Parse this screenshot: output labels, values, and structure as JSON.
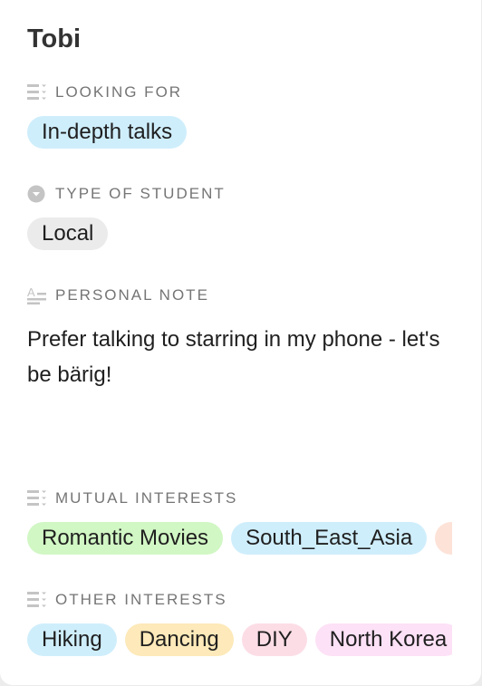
{
  "record": {
    "name": "Tobi"
  },
  "looking_for": {
    "label": "LOOKING FOR",
    "icon": "multiple-select-icon",
    "tags": [
      "In-depth talks"
    ]
  },
  "type_of_student": {
    "label": "TYPE OF STUDENT",
    "icon": "single-select-icon",
    "tags": [
      "Local"
    ]
  },
  "personal_note": {
    "label": "PERSONAL NOTE",
    "icon": "long-text-icon",
    "text": "Prefer talking to starring in my phone - let's be bärig!"
  },
  "mutual_interests": {
    "label": "MUTUAL INTERESTS",
    "icon": "multiple-select-icon",
    "tags": [
      "Romantic Movies",
      "South_East_Asia",
      ""
    ]
  },
  "other_interests": {
    "label": "OTHER INTERESTS",
    "icon": "multiple-select-icon",
    "tags": [
      "Hiking",
      "Dancing",
      "DIY",
      "North Korea"
    ]
  },
  "colors": {
    "blue": "#cfeefc",
    "gray": "#ebebeb",
    "green": "#d1f7c4",
    "peach": "#fde2d8",
    "yellow": "#fde9b9",
    "pink": "#fcdde6",
    "magenta": "#fde1f6"
  }
}
